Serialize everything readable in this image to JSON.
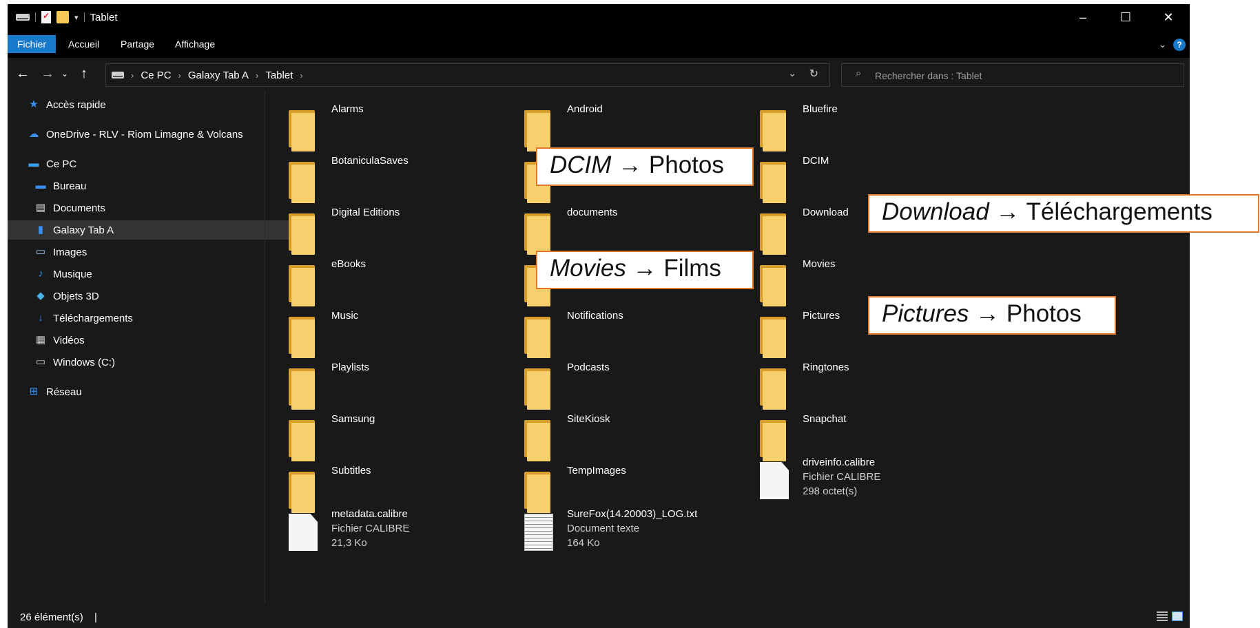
{
  "window": {
    "title": "Tablet",
    "controls": [
      "–",
      "☐",
      "✕"
    ]
  },
  "ribbon": {
    "tabs": [
      "Fichier",
      "Accueil",
      "Partage",
      "Affichage"
    ]
  },
  "address": {
    "crumbs": [
      "Ce PC",
      "Galaxy Tab A",
      "Tablet"
    ]
  },
  "search": {
    "placeholder": "Rechercher dans : Tablet"
  },
  "sidebar": {
    "items": [
      {
        "label": "Accès rapide",
        "icon": "star-icon"
      },
      {
        "label": "OneDrive - RLV - Riom Limagne & Volcans",
        "icon": "cloud-icon"
      },
      {
        "label": "Ce PC",
        "icon": "computer-icon"
      },
      {
        "label": "Bureau",
        "icon": "desktop-icon"
      },
      {
        "label": "Documents",
        "icon": "documents-icon"
      },
      {
        "label": "Galaxy Tab A",
        "icon": "phone-icon"
      },
      {
        "label": "Images",
        "icon": "images-icon"
      },
      {
        "label": "Musique",
        "icon": "music-icon"
      },
      {
        "label": "Objets 3D",
        "icon": "cube-icon"
      },
      {
        "label": "Téléchargements",
        "icon": "download-icon"
      },
      {
        "label": "Vidéos",
        "icon": "video-icon"
      },
      {
        "label": "Windows (C:)",
        "icon": "drive-icon"
      },
      {
        "label": "Réseau",
        "icon": "network-icon"
      }
    ]
  },
  "files": [
    {
      "name": "Alarms",
      "type": "folder"
    },
    {
      "name": "Android",
      "type": "folder"
    },
    {
      "name": "Bluefire",
      "type": "folder"
    },
    {
      "name": "BotaniculaSaves",
      "type": "folder"
    },
    {
      "name": "",
      "type": "folder"
    },
    {
      "name": "DCIM",
      "type": "folder"
    },
    {
      "name": "Digital Editions",
      "type": "folder"
    },
    {
      "name": "documents",
      "type": "folder"
    },
    {
      "name": "Download",
      "type": "folder"
    },
    {
      "name": "eBooks",
      "type": "folder"
    },
    {
      "name": "",
      "type": "folder"
    },
    {
      "name": "Movies",
      "type": "folder"
    },
    {
      "name": "Music",
      "type": "folder"
    },
    {
      "name": "Notifications",
      "type": "folder"
    },
    {
      "name": "Pictures",
      "type": "folder"
    },
    {
      "name": "Playlists",
      "type": "folder"
    },
    {
      "name": "Podcasts",
      "type": "folder"
    },
    {
      "name": "Ringtones",
      "type": "folder"
    },
    {
      "name": "Samsung",
      "type": "folder"
    },
    {
      "name": "SiteKiosk",
      "type": "folder"
    },
    {
      "name": "Snapchat",
      "type": "folder"
    },
    {
      "name": "Subtitles",
      "type": "folder"
    },
    {
      "name": "TempImages",
      "type": "folder"
    },
    {
      "name": "driveinfo.calibre",
      "type": "file",
      "kind": "Fichier CALIBRE",
      "size": "298 octet(s)"
    },
    {
      "name": "metadata.calibre",
      "type": "file",
      "kind": "Fichier CALIBRE",
      "size": "21,3 Ko"
    },
    {
      "name": "SureFox(14.20003)_LOG.txt",
      "type": "txt",
      "kind": "Document texte",
      "size": "164 Ko"
    }
  ],
  "status": {
    "count": "26 élément(s)"
  },
  "callouts": [
    {
      "term": "DCIM",
      "arrow": "→",
      "meaning": "Photos"
    },
    {
      "term": "Download",
      "arrow": "→",
      "meaning": "Téléchargements"
    },
    {
      "term": "Movies",
      "arrow": "→",
      "meaning": "Films"
    },
    {
      "term": "Pictures",
      "arrow": "→",
      "meaning": "Photos"
    }
  ],
  "colors": {
    "accent": "#1979ca",
    "folder": "#f7d06d",
    "callout_border": "#e0772c",
    "background": "#191919"
  }
}
